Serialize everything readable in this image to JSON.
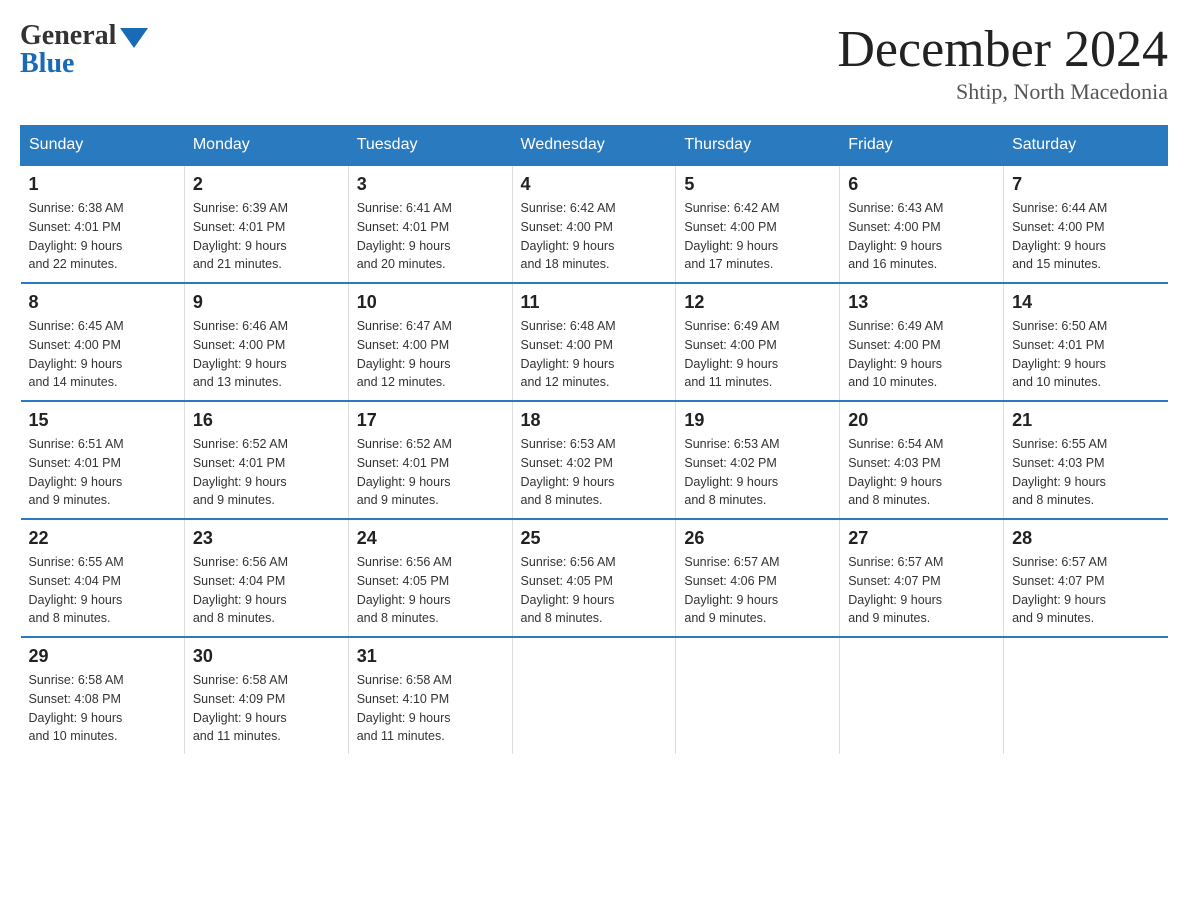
{
  "header": {
    "logo_general": "General",
    "logo_blue": "Blue",
    "month_title": "December 2024",
    "location": "Shtip, North Macedonia"
  },
  "days_of_week": [
    "Sunday",
    "Monday",
    "Tuesday",
    "Wednesday",
    "Thursday",
    "Friday",
    "Saturday"
  ],
  "weeks": [
    [
      {
        "day": "1",
        "sunrise": "6:38 AM",
        "sunset": "4:01 PM",
        "daylight": "9 hours and 22 minutes."
      },
      {
        "day": "2",
        "sunrise": "6:39 AM",
        "sunset": "4:01 PM",
        "daylight": "9 hours and 21 minutes."
      },
      {
        "day": "3",
        "sunrise": "6:41 AM",
        "sunset": "4:01 PM",
        "daylight": "9 hours and 20 minutes."
      },
      {
        "day": "4",
        "sunrise": "6:42 AM",
        "sunset": "4:00 PM",
        "daylight": "9 hours and 18 minutes."
      },
      {
        "day": "5",
        "sunrise": "6:42 AM",
        "sunset": "4:00 PM",
        "daylight": "9 hours and 17 minutes."
      },
      {
        "day": "6",
        "sunrise": "6:43 AM",
        "sunset": "4:00 PM",
        "daylight": "9 hours and 16 minutes."
      },
      {
        "day": "7",
        "sunrise": "6:44 AM",
        "sunset": "4:00 PM",
        "daylight": "9 hours and 15 minutes."
      }
    ],
    [
      {
        "day": "8",
        "sunrise": "6:45 AM",
        "sunset": "4:00 PM",
        "daylight": "9 hours and 14 minutes."
      },
      {
        "day": "9",
        "sunrise": "6:46 AM",
        "sunset": "4:00 PM",
        "daylight": "9 hours and 13 minutes."
      },
      {
        "day": "10",
        "sunrise": "6:47 AM",
        "sunset": "4:00 PM",
        "daylight": "9 hours and 12 minutes."
      },
      {
        "day": "11",
        "sunrise": "6:48 AM",
        "sunset": "4:00 PM",
        "daylight": "9 hours and 12 minutes."
      },
      {
        "day": "12",
        "sunrise": "6:49 AM",
        "sunset": "4:00 PM",
        "daylight": "9 hours and 11 minutes."
      },
      {
        "day": "13",
        "sunrise": "6:49 AM",
        "sunset": "4:00 PM",
        "daylight": "9 hours and 10 minutes."
      },
      {
        "day": "14",
        "sunrise": "6:50 AM",
        "sunset": "4:01 PM",
        "daylight": "9 hours and 10 minutes."
      }
    ],
    [
      {
        "day": "15",
        "sunrise": "6:51 AM",
        "sunset": "4:01 PM",
        "daylight": "9 hours and 9 minutes."
      },
      {
        "day": "16",
        "sunrise": "6:52 AM",
        "sunset": "4:01 PM",
        "daylight": "9 hours and 9 minutes."
      },
      {
        "day": "17",
        "sunrise": "6:52 AM",
        "sunset": "4:01 PM",
        "daylight": "9 hours and 9 minutes."
      },
      {
        "day": "18",
        "sunrise": "6:53 AM",
        "sunset": "4:02 PM",
        "daylight": "9 hours and 8 minutes."
      },
      {
        "day": "19",
        "sunrise": "6:53 AM",
        "sunset": "4:02 PM",
        "daylight": "9 hours and 8 minutes."
      },
      {
        "day": "20",
        "sunrise": "6:54 AM",
        "sunset": "4:03 PM",
        "daylight": "9 hours and 8 minutes."
      },
      {
        "day": "21",
        "sunrise": "6:55 AM",
        "sunset": "4:03 PM",
        "daylight": "9 hours and 8 minutes."
      }
    ],
    [
      {
        "day": "22",
        "sunrise": "6:55 AM",
        "sunset": "4:04 PM",
        "daylight": "9 hours and 8 minutes."
      },
      {
        "day": "23",
        "sunrise": "6:56 AM",
        "sunset": "4:04 PM",
        "daylight": "9 hours and 8 minutes."
      },
      {
        "day": "24",
        "sunrise": "6:56 AM",
        "sunset": "4:05 PM",
        "daylight": "9 hours and 8 minutes."
      },
      {
        "day": "25",
        "sunrise": "6:56 AM",
        "sunset": "4:05 PM",
        "daylight": "9 hours and 8 minutes."
      },
      {
        "day": "26",
        "sunrise": "6:57 AM",
        "sunset": "4:06 PM",
        "daylight": "9 hours and 9 minutes."
      },
      {
        "day": "27",
        "sunrise": "6:57 AM",
        "sunset": "4:07 PM",
        "daylight": "9 hours and 9 minutes."
      },
      {
        "day": "28",
        "sunrise": "6:57 AM",
        "sunset": "4:07 PM",
        "daylight": "9 hours and 9 minutes."
      }
    ],
    [
      {
        "day": "29",
        "sunrise": "6:58 AM",
        "sunset": "4:08 PM",
        "daylight": "9 hours and 10 minutes."
      },
      {
        "day": "30",
        "sunrise": "6:58 AM",
        "sunset": "4:09 PM",
        "daylight": "9 hours and 11 minutes."
      },
      {
        "day": "31",
        "sunrise": "6:58 AM",
        "sunset": "4:10 PM",
        "daylight": "9 hours and 11 minutes."
      },
      null,
      null,
      null,
      null
    ]
  ]
}
